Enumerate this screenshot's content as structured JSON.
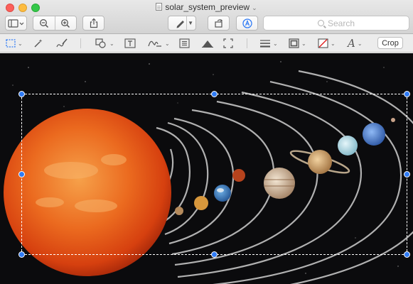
{
  "window": {
    "title": "solar_system_preview"
  },
  "toolbar": {
    "search_placeholder": "Search",
    "icons": [
      "sidebar-icon",
      "zoom-out-icon",
      "zoom-in-icon",
      "share-icon",
      "pen-icon",
      "rotate-icon",
      "markup-icon"
    ]
  },
  "markup": {
    "crop_label": "Crop",
    "icons": [
      "rect-selection-icon",
      "instant-alpha-icon",
      "sketch-icon",
      "shapes-icon",
      "text-icon",
      "sign-icon",
      "adjust-color-icon",
      "adjust-size-icon",
      "shape-style-icon",
      "border-color-icon",
      "fill-color-icon",
      "text-style-icon"
    ]
  },
  "colors": {
    "selection_handle": "#2f7bf5",
    "canvas_bg": "#0b0b0d",
    "sun": "#e8521a"
  }
}
